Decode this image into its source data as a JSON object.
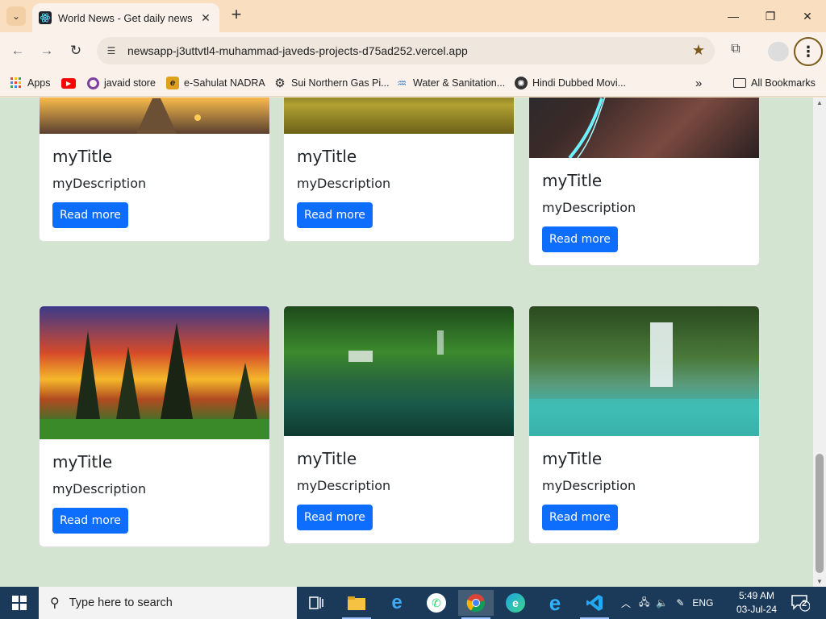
{
  "browser": {
    "tab_title": "World News - Get daily news fr",
    "tab_close": "✕",
    "new_tab": "+",
    "url": "newsapp-j3uttvtl4-muhammad-javeds-projects-d75ad252.vercel.app",
    "window_controls": {
      "minimize": "—",
      "restore": "❐",
      "close": "✕"
    }
  },
  "bookmarks": {
    "items": [
      {
        "label": "Apps",
        "icon": "apps-grid-icon"
      },
      {
        "label": "",
        "icon": "youtube-icon"
      },
      {
        "label": "javaid store",
        "icon": "ring-icon"
      },
      {
        "label": "e-Sahulat NADRA",
        "icon": "e-sahulat-icon"
      },
      {
        "label": "Sui Northern Gas Pi...",
        "icon": "gear-logo-icon"
      },
      {
        "label": "Water & Sanitation...",
        "icon": "water-icon"
      },
      {
        "label": "Hindi Dubbed Movi...",
        "icon": "film-reel-icon"
      }
    ],
    "overflow": "»",
    "all_bookmarks": "All Bookmarks"
  },
  "page": {
    "cards": [
      {
        "title": "myTitle",
        "description": "myDescription",
        "button": "Read more",
        "image": "boardwalk-sunset"
      },
      {
        "title": "myTitle",
        "description": "myDescription",
        "button": "Read more",
        "image": "forest-reflection"
      },
      {
        "title": "myTitle",
        "description": "myDescription",
        "button": "Read more",
        "image": "glowing-river"
      },
      {
        "title": "myTitle",
        "description": "myDescription",
        "button": "Read more",
        "image": "sunset-pines"
      },
      {
        "title": "myTitle",
        "description": "myDescription",
        "button": "Read more",
        "image": "green-waterfall"
      },
      {
        "title": "myTitle",
        "description": "myDescription",
        "button": "Read more",
        "image": "turquoise-waterfall"
      }
    ],
    "accent_color": "#0d6efd",
    "background_color": "#d3e4d0"
  },
  "taskbar": {
    "search_placeholder": "Type here to search",
    "language": "ENG",
    "time": "5:49 AM",
    "date": "03-Jul-24",
    "notification_count": "2"
  }
}
